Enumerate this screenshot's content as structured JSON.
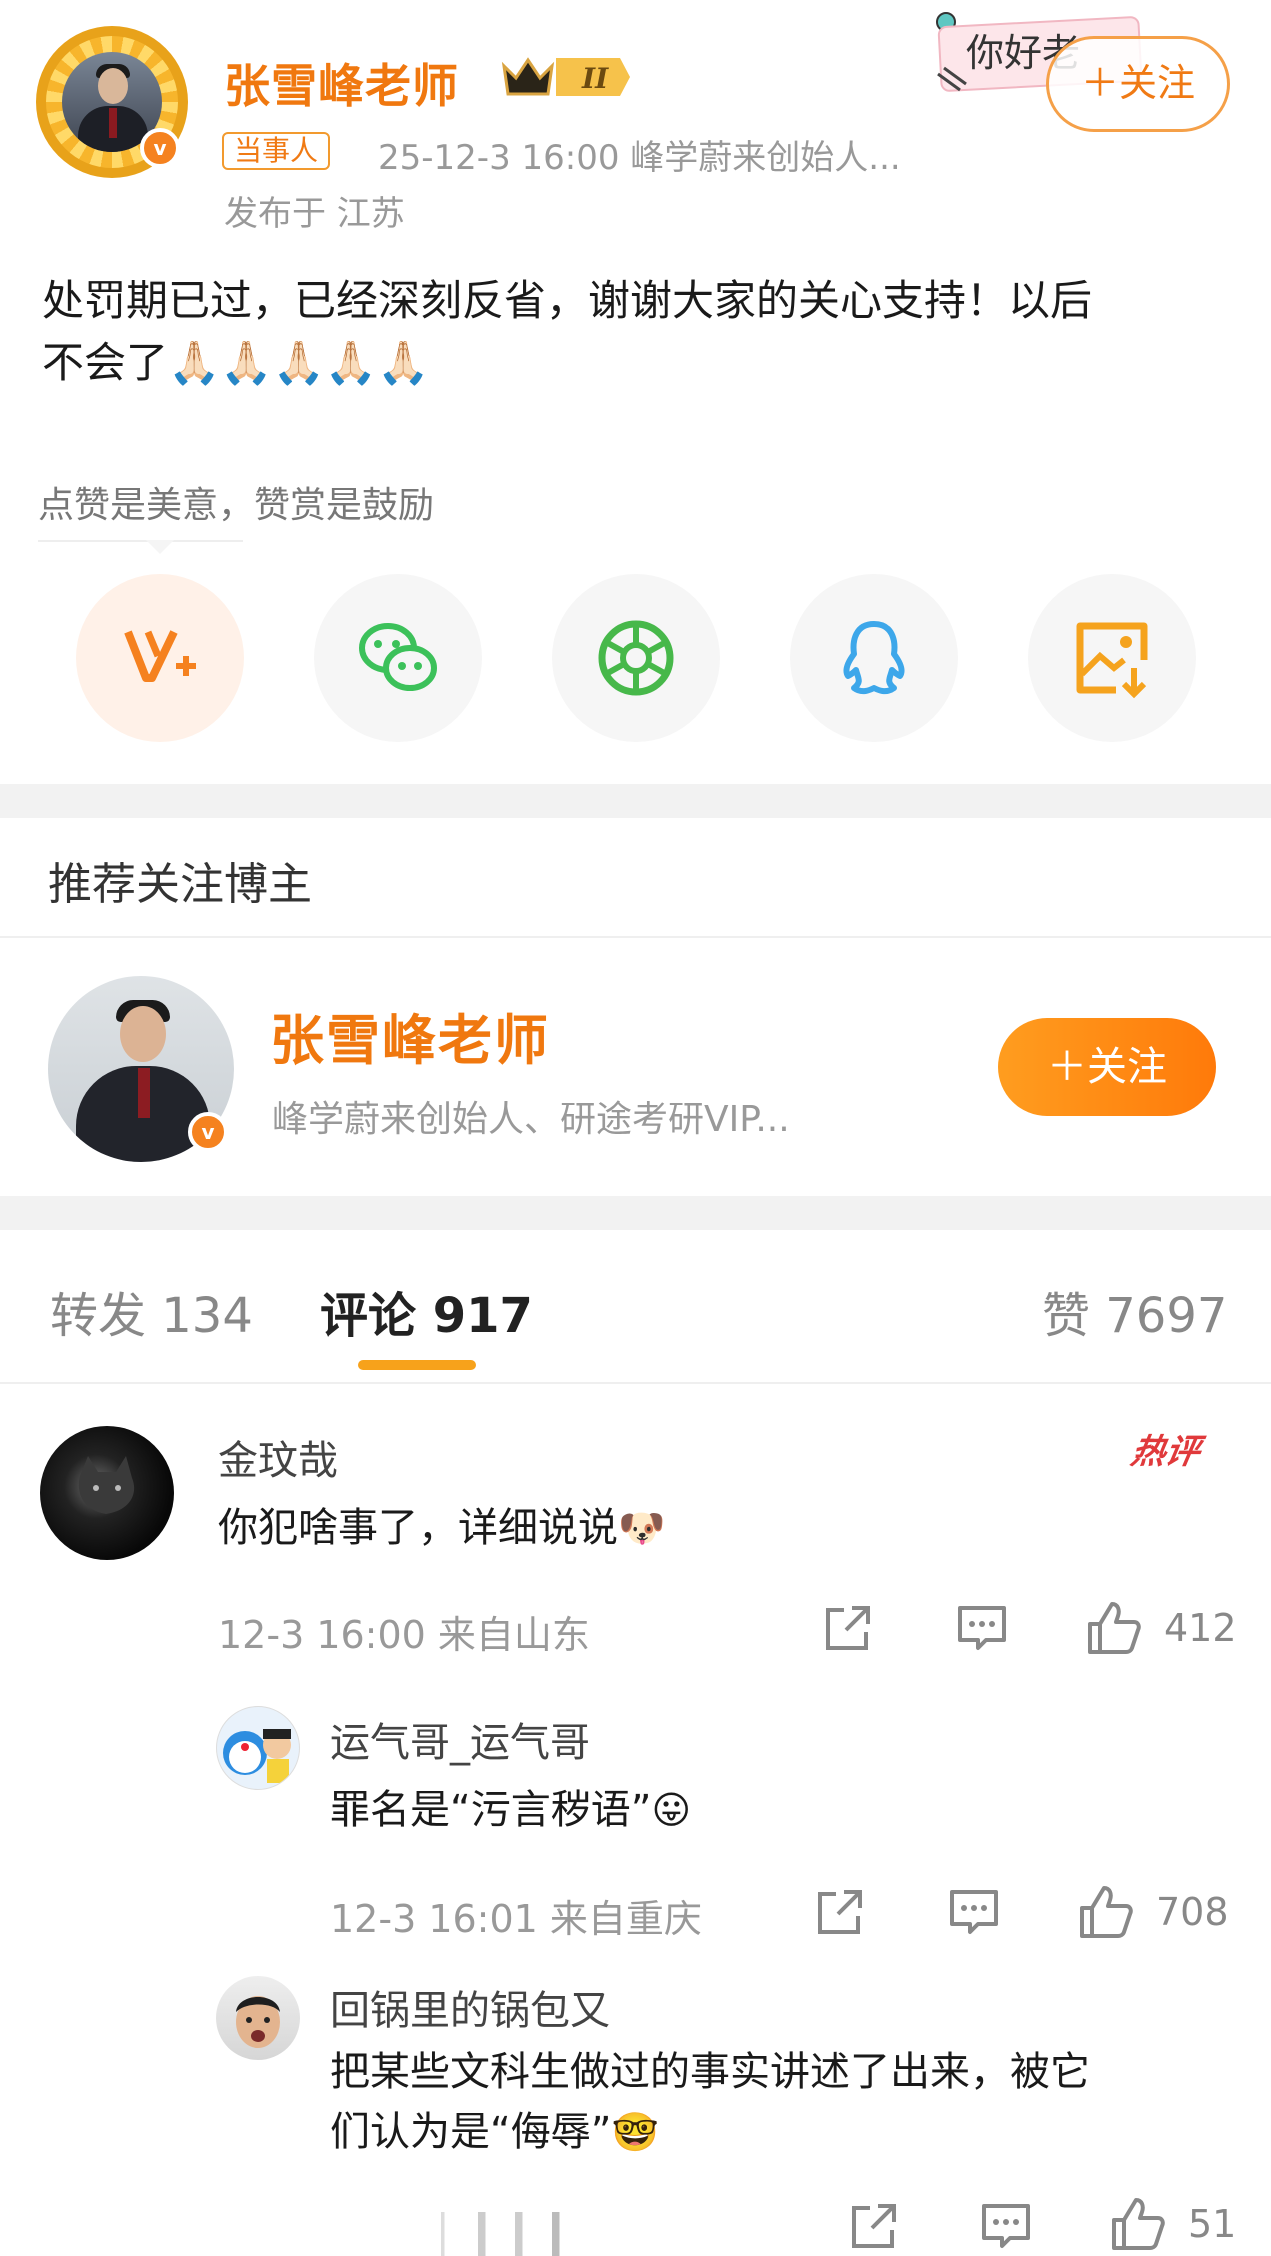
{
  "post": {
    "author": "张雪峰老师",
    "role_tag": "当事人",
    "time_source": "25-12-3 16:00  峰学蔚来创始人...",
    "location": "发布于 江苏",
    "follow_label": "＋关注",
    "text_line1": "处罚期已过，已经深刻反省，谢谢大家的关心支持！以后",
    "text_line2": "不会了🙏🏻🙏🏻🙏🏻🙏🏻🙏🏻",
    "level_badge": "II",
    "stamp_text": "你好老"
  },
  "reward_hint": "点赞是美意，赞赏是鼓励",
  "share_icons": [
    "v-plus-icon",
    "wechat-icon",
    "moments-icon",
    "qq-icon",
    "save-image-icon"
  ],
  "recommend": {
    "section_title": "推荐关注博主",
    "name": "张雪峰老师",
    "desc": "峰学蔚来创始人、研途考研VIP...",
    "follow_label": "＋关注"
  },
  "tabs": {
    "repost": "转发 134",
    "comments": "评论 917",
    "likes": "赞 7697"
  },
  "comments": [
    {
      "user": "金玟哉",
      "text": "你犯啥事了，详细说说",
      "emoji": "🐶",
      "meta": "12-3 16:00  来自山东",
      "likes": "412",
      "badge": "热评"
    },
    {
      "user": "运气哥_运气哥",
      "text": "罪名是“污言秽语”",
      "emoji": "😛",
      "meta": "12-3 16:01  来自重庆",
      "likes": "708"
    },
    {
      "user": "回锅里的锅包又",
      "text_line1": "把某些文科生做过的事实讲述了出来，被它",
      "text_line2": "们认为是“侮辱”",
      "emoji": "🤓",
      "likes": "51"
    }
  ],
  "colors": {
    "brand_orange": "#f0780f",
    "follow_gradient_start": "#ff9d1f",
    "follow_gradient_end": "#ff7a0a",
    "hot_red": "#e0393b",
    "tab_underline": "#f7a21b"
  }
}
